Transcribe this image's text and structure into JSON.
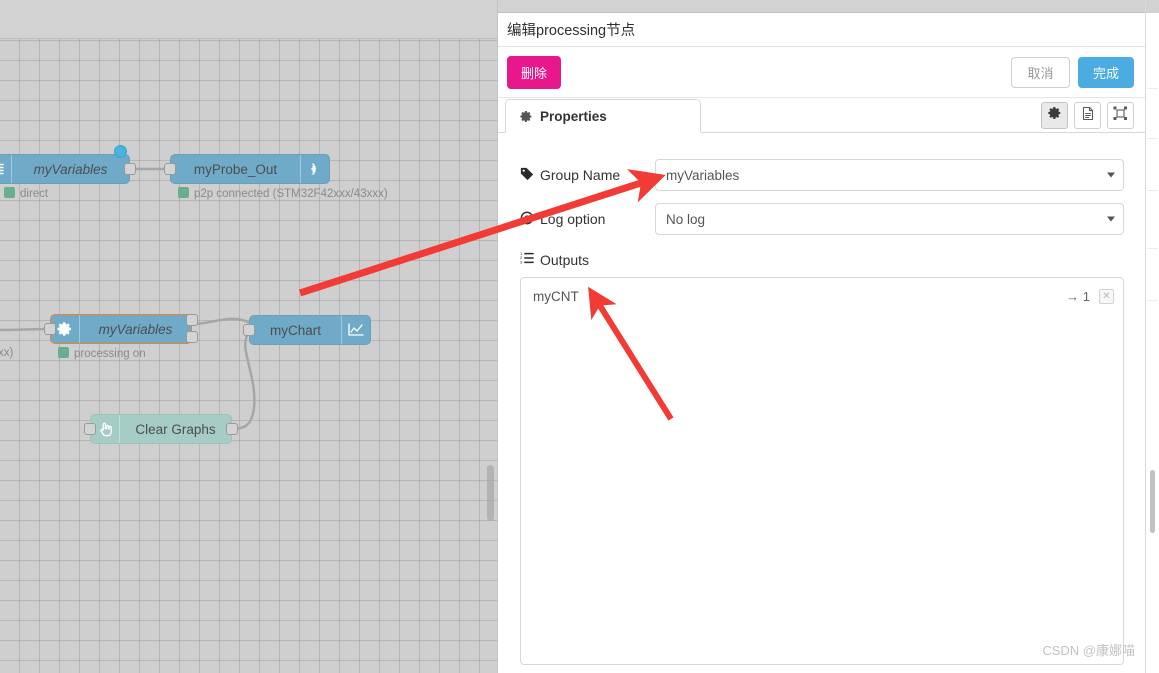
{
  "editor_panel": {
    "title": "编辑processing节点",
    "buttons": {
      "delete": "删除",
      "cancel": "取消",
      "done": "完成"
    },
    "tabs": [
      {
        "label": "Properties",
        "icon": "gear-icon",
        "active": true
      }
    ],
    "tab_tools": [
      {
        "icon": "gear-icon",
        "active": true
      },
      {
        "icon": "document-icon",
        "active": false
      },
      {
        "icon": "appearance-icon",
        "active": false
      }
    ],
    "fields": [
      {
        "label": "Group Name",
        "icon": "tag-icon",
        "value": "myVariables",
        "control": "select"
      },
      {
        "label": "Log option",
        "icon": "radio-target-icon",
        "value": "No log",
        "control": "select"
      }
    ],
    "outputs": {
      "label": "Outputs",
      "icon": "ordered-list-icon",
      "rows": [
        {
          "name": "myCNT",
          "count": "→ 1",
          "delete_icon": "✕"
        }
      ]
    }
  },
  "canvas": {
    "nodes": [
      {
        "id": "myVariables-top",
        "label": "myVariables",
        "left_icon": "lines-icon",
        "status": "direct",
        "selected": false
      },
      {
        "id": "myProbe_Out",
        "label": "myProbe_Out",
        "right_icon": "broadcast-icon",
        "status": "p2p connected (STM32F42xxx/43xxx)",
        "selected": false
      },
      {
        "id": "myVariables-selected",
        "label": "myVariables",
        "left_icon": "gear-icon",
        "status": "processing on",
        "selected": true
      },
      {
        "id": "myChart",
        "label": "myChart",
        "right_icon": "chart-icon",
        "status": "",
        "selected": false
      },
      {
        "id": "clear-graphs",
        "label": "Clear Graphs",
        "left_icon": "hand-click-icon",
        "status": "",
        "selected": false
      }
    ],
    "left_partial_status": "xx)"
  },
  "watermark": "CSDN @康娜喵",
  "colors": {
    "delete_button": "#e8188c",
    "done_button": "#4aace0",
    "node_blue": "#6fabc9",
    "node_teal": "#a6ccc6",
    "selection_border": "#e8842a",
    "status_dot_green": "#69af8f",
    "annotation_arrow": "#f23b35"
  }
}
